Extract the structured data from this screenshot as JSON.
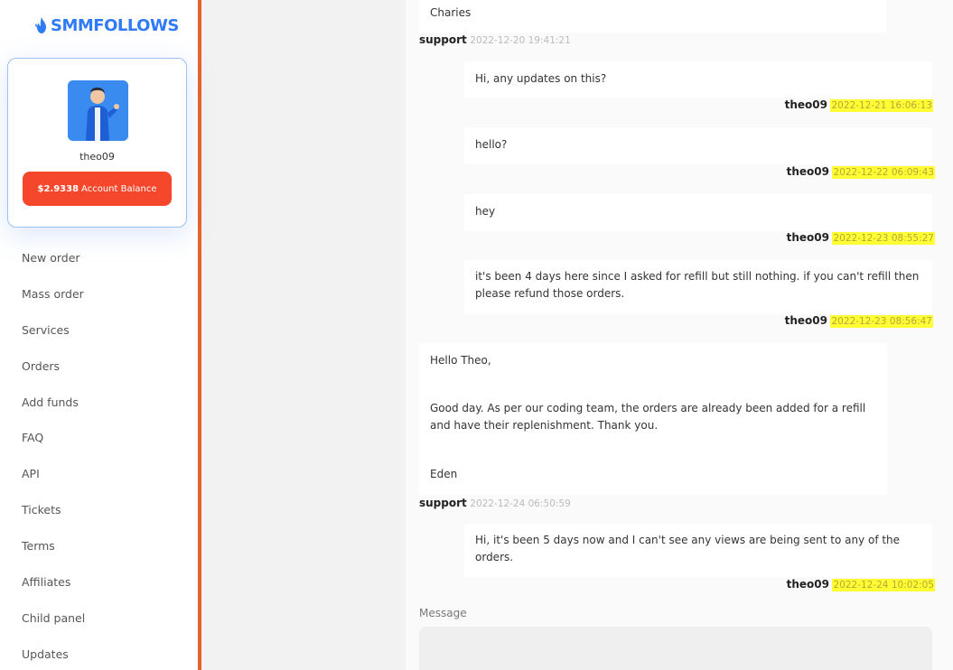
{
  "brand": {
    "name": "SMMFOLLOWS"
  },
  "profile": {
    "username": "theo09",
    "balance_amount": "$2.9338",
    "balance_label": "Account Balance"
  },
  "nav": {
    "items": [
      {
        "label": "New order"
      },
      {
        "label": "Mass order"
      },
      {
        "label": "Services"
      },
      {
        "label": "Orders"
      },
      {
        "label": "Add funds"
      },
      {
        "label": "FAQ"
      },
      {
        "label": "API"
      },
      {
        "label": "Tickets"
      },
      {
        "label": "Terms"
      },
      {
        "label": "Affiliates"
      },
      {
        "label": "Child panel"
      },
      {
        "label": "Updates"
      }
    ]
  },
  "thread": {
    "messages": [
      {
        "text": "Charies",
        "author": "support",
        "time": "2022-12-20 19:41:21"
      },
      {
        "text": "Hi, any updates on this?",
        "author": "theo09",
        "time": "2022-12-21 16:06:13"
      },
      {
        "text": "hello?",
        "author": "theo09",
        "time": "2022-12-22 06:09:43"
      },
      {
        "text": "hey",
        "author": "theo09",
        "time": "2022-12-23 08:55:27"
      },
      {
        "text": "it's been 4 days here since I asked for refill but still nothing. if you can't refill then please refund those orders.",
        "author": "theo09",
        "time": "2022-12-23 08:56:47"
      },
      {
        "text_lines": [
          "Hello Theo,",
          "Good day. As per our coding team, the orders are already been added for a refill and have their replenishment. Thank you.",
          "Eden"
        ],
        "author": "support",
        "time": "2022-12-24 06:50:59"
      },
      {
        "text": "Hi, it's been 5 days now and I can't see any views are being sent to any of the orders.",
        "author": "theo09",
        "time": "2022-12-24 10:02:05"
      }
    ],
    "message_label": "Message"
  },
  "colors": {
    "brand_blue": "#2f7bf5",
    "accent_orange": "#e8622c",
    "balance_red": "#f5472c",
    "highlight_yellow": "#ffff33"
  }
}
